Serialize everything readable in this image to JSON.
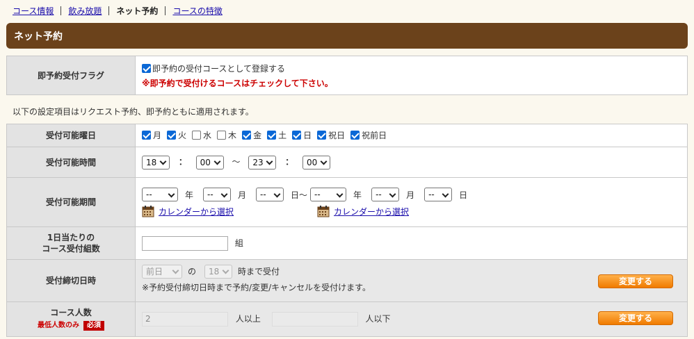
{
  "tabs": [
    {
      "label": "コース情報",
      "current": false
    },
    {
      "label": "飲み放題",
      "current": false
    },
    {
      "label": "ネット予約",
      "current": true
    },
    {
      "label": "コースの特徴",
      "current": false
    }
  ],
  "page_title": "ネット予約",
  "flag": {
    "header": "即予約受付フラグ",
    "checkbox_label": "即予約の受付コースとして登録する",
    "checked": true,
    "warning": "※即予約で受付けるコースはチェックして下さい。"
  },
  "note": "以下の設定項目はリクエスト予約、即予約ともに適用されます。",
  "days": {
    "header": "受付可能曜日",
    "items": [
      {
        "label": "月",
        "checked": true
      },
      {
        "label": "火",
        "checked": true
      },
      {
        "label": "水",
        "checked": false
      },
      {
        "label": "木",
        "checked": false
      },
      {
        "label": "金",
        "checked": true
      },
      {
        "label": "土",
        "checked": true
      },
      {
        "label": "日",
        "checked": true
      },
      {
        "label": "祝日",
        "checked": true
      },
      {
        "label": "祝前日",
        "checked": true
      }
    ]
  },
  "time": {
    "header": "受付可能時間",
    "start_hour": "18",
    "start_min": "00",
    "end_hour": "23",
    "end_min": "00",
    "colon": "：",
    "tilde": "〜"
  },
  "period": {
    "header": "受付可能期間",
    "start_year": "--",
    "start_month": "--",
    "start_day": "--",
    "end_year": "--",
    "end_month": "--",
    "end_day": "--",
    "year_unit": "年",
    "month_unit": "月",
    "day_unit": "日",
    "day_tilde_unit": "日〜",
    "calendar_link": "カレンダーから選択"
  },
  "groups": {
    "header_line1": "1日当たりの",
    "header_line2": "コース受付組数",
    "value": "",
    "unit": "組"
  },
  "deadline": {
    "header": "受付締切日時",
    "day_value": "前日",
    "of": "の",
    "hour_value": "18",
    "suffix": "時まで受付",
    "note": "※予約受付締切日時まで予約/変更/キャンセルを受付けます。",
    "button": "変更する"
  },
  "people": {
    "header": "コース人数",
    "min_only": "最低人数のみ",
    "required": "必須",
    "min_value": "2",
    "min_unit": "人以上",
    "max_value": "",
    "max_unit": "人以下",
    "button": "変更する"
  },
  "colors": {
    "title_bar": "#6b421b",
    "header_cell": "#e3e3e3",
    "warning_red": "#cc0000",
    "button_orange": "#f08c1a",
    "link_blue": "#1a0dab",
    "checkbox_blue": "#0a68d6"
  }
}
